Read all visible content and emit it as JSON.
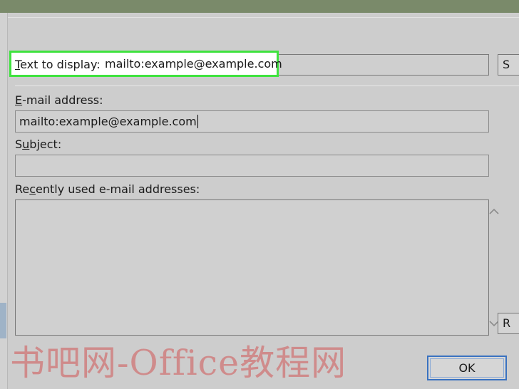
{
  "dialog": {
    "text_to_display_label_hotkey": "T",
    "text_to_display_label_rest": "ext to display:",
    "text_to_display_value": "mailto:example@example.com",
    "email_label_hotkey": "E",
    "email_label_rest": "-mail address:",
    "email_value": "mailto:example@example.com",
    "subject_label_prefix": "S",
    "subject_label_hotkey": "u",
    "subject_label_rest": "bject:",
    "subject_value": "",
    "recent_label_prefix": "Re",
    "recent_label_hotkey": "c",
    "recent_label_rest": "ently used e-mail addresses:",
    "ok_label": "OK",
    "side_button_top_label": "S",
    "side_button_bottom_label": "R"
  },
  "watermark": {
    "text": "书吧网-Office教程网"
  },
  "colors": {
    "highlight": "#3fe33f",
    "ok_border": "#3a72c0",
    "titlebar": "#7a8a6a"
  },
  "icons": {
    "scroll_up": "chevron-up-icon",
    "scroll_down": "chevron-down-icon"
  }
}
